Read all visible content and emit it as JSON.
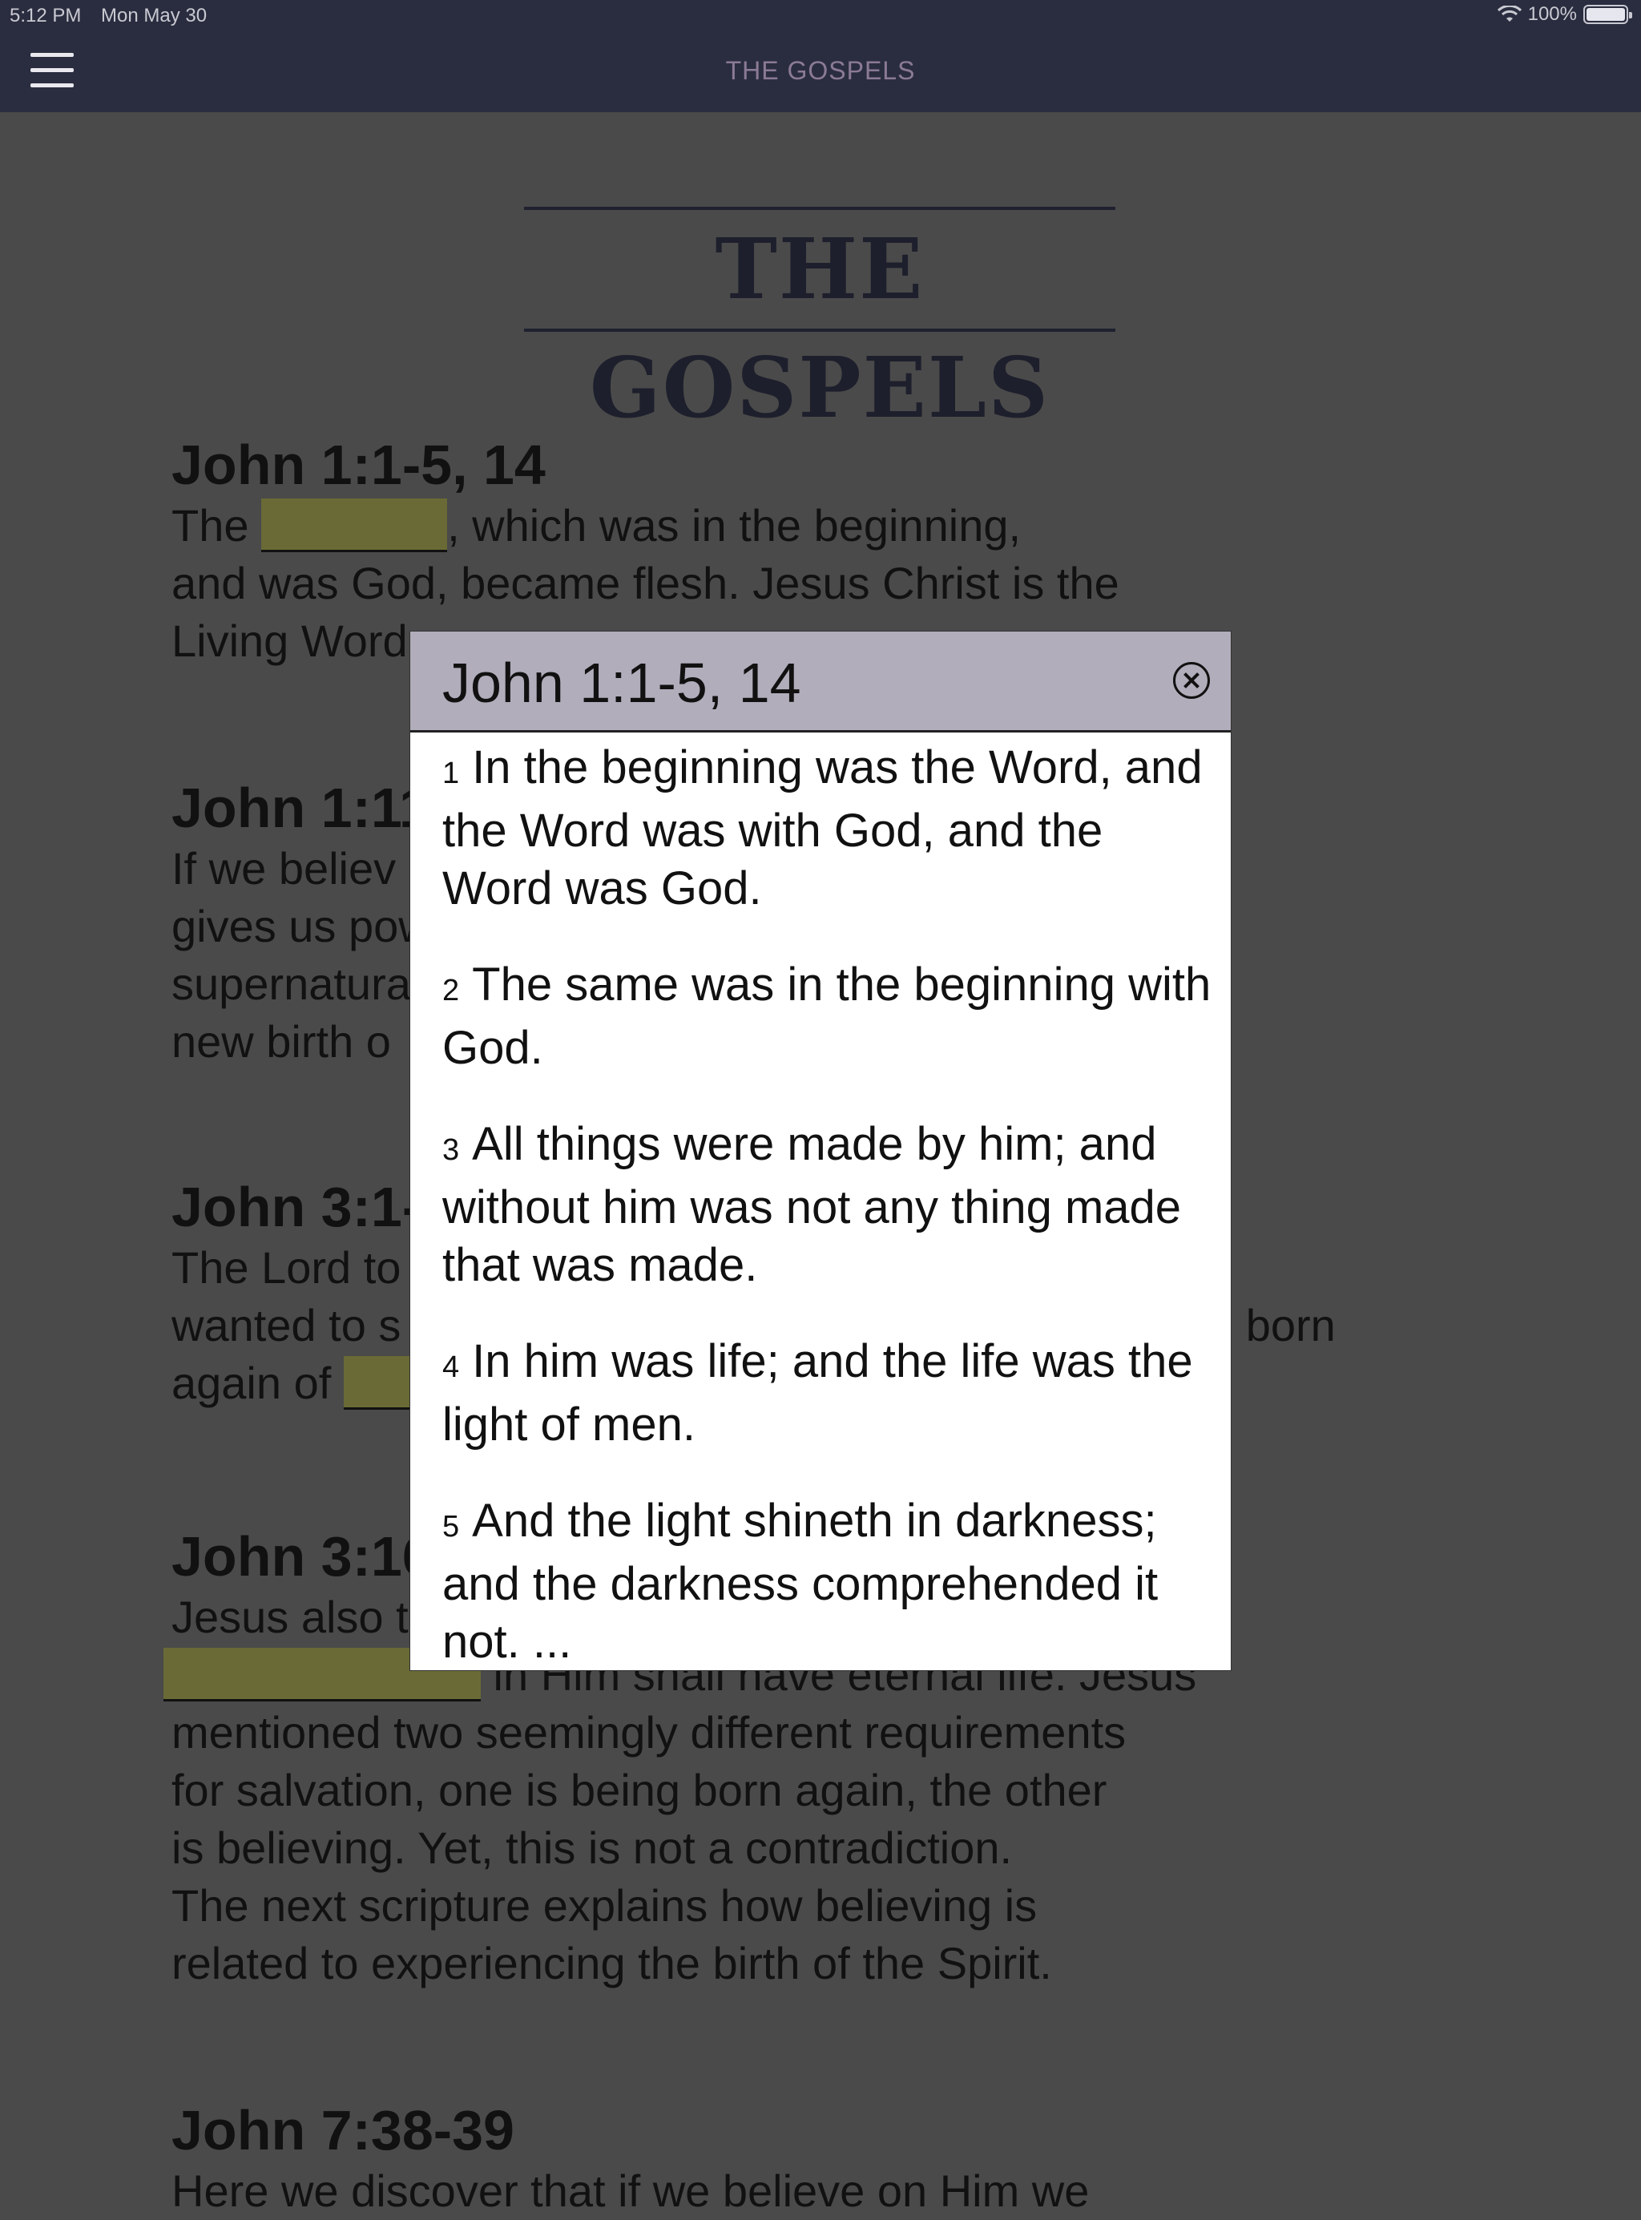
{
  "status": {
    "time": "5:12 PM",
    "date": "Mon May 30",
    "battery": "100%"
  },
  "nav": {
    "title": "THE GOSPELS"
  },
  "page": {
    "heading": "THE GOSPELS"
  },
  "sections": [
    {
      "title": "John 1:1-5, 14",
      "lines": [
        "The ",
        ", which was in the beginning,",
        "and was God, became flesh. Jesus Christ is the",
        "Living Word"
      ]
    },
    {
      "title": "John 1:11",
      "lines": [
        "If we believ",
        "gives us pow",
        "supernatural",
        "new birth o"
      ]
    },
    {
      "title": "John 3:1-",
      "lines": [
        "The Lord to",
        "wanted to s",
        "e born",
        "again of "
      ]
    },
    {
      "title": "John 3:16",
      "lines": [
        "Jesus also t",
        " in Him shall have eternal life. Jesus",
        "mentioned two seemingly different requirements",
        "for salvation, one is being born again, the other",
        "is believing. Yet, this is not a contradiction.",
        "The next scripture explains how believing is",
        "related to experiencing the birth of the Spirit."
      ]
    },
    {
      "title": "John 7:38-39",
      "lines": [
        "Here we discover that if we believe on Him we"
      ]
    }
  ],
  "modal": {
    "title": "John 1:1-5, 14",
    "verses": [
      {
        "num": "1",
        "text": "In the beginning was the Word, and the Word was with God, and the Word was God."
      },
      {
        "num": "2",
        "text": "The same was in the beginning with God."
      },
      {
        "num": "3",
        "text": "All things were made by him; and without him was not any thing made that was made."
      },
      {
        "num": "4",
        "text": "In him was life; and the life was the light of men."
      },
      {
        "num": "5",
        "text": "And the light shineth in darkness; and the darkness comprehended it not. ..."
      }
    ]
  }
}
